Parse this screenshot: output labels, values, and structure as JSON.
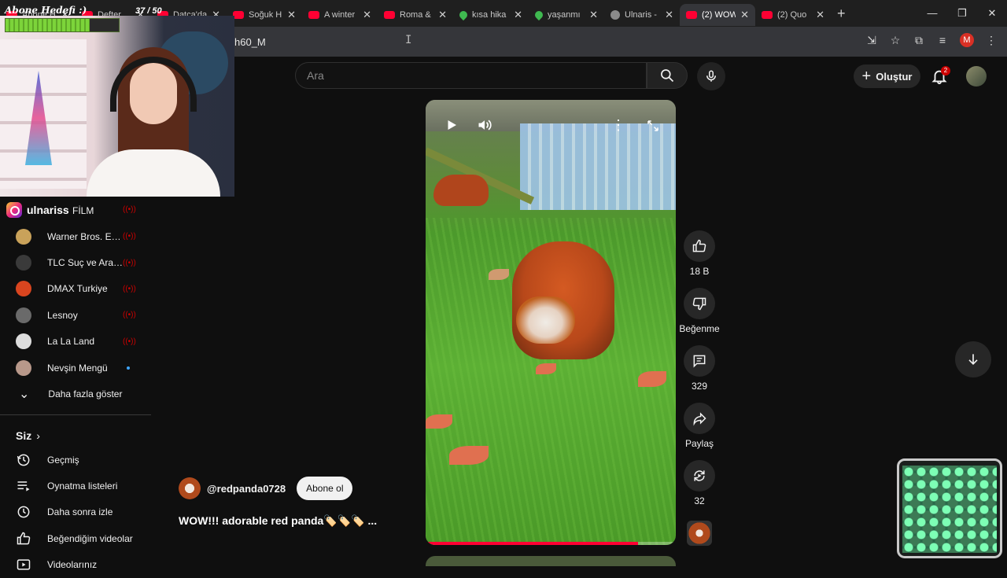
{
  "browser": {
    "tabs": [
      {
        "title": "Abone Hedefi :) zam",
        "icon": "youtube-icon"
      },
      {
        "title": "Defter",
        "icon": "youtube-icon"
      },
      {
        "title": "Datça'da",
        "icon": "youtube-icon"
      },
      {
        "title": "Soğuk H",
        "icon": "youtube-icon"
      },
      {
        "title": "A winter",
        "icon": "youtube-icon"
      },
      {
        "title": "Roma &",
        "icon": "youtube-icon"
      },
      {
        "title": "kısa hika",
        "icon": "leaf-icon"
      },
      {
        "title": "yaşanmı",
        "icon": "leaf-icon"
      },
      {
        "title": "Ulnaris -",
        "icon": "globe-icon"
      },
      {
        "title": "(2) WOW",
        "icon": "youtube-icon",
        "active": true
      },
      {
        "title": "(2) Quo",
        "icon": "youtube-icon"
      }
    ],
    "url_fragment": "h60_M",
    "profile_initial": "M"
  },
  "overlay": {
    "goal_label": "Abone Hedefi :)",
    "goal_count": "37 / 50",
    "goal_progress": 0.74,
    "instagram_handle": "ulnariss"
  },
  "header": {
    "search_placeholder": "Ara",
    "create_label": "Oluştur",
    "notification_count": "2"
  },
  "sidebar": {
    "partial_item": {
      "label": "FİLM",
      "live": true
    },
    "subscriptions": [
      {
        "name": "Warner Bros. Entertainment",
        "avatar_color": "#c9a25a",
        "live": true
      },
      {
        "name": "TLC Suç ve Araştırma",
        "avatar_color": "#3a3a3a",
        "live": true
      },
      {
        "name": "DMAX Turkiye",
        "avatar_color": "#d9451f",
        "live": true
      },
      {
        "name": "Lesnoy",
        "avatar_color": "#6a6a6a",
        "live": true
      },
      {
        "name": "La La Land",
        "avatar_color": "#dddddd",
        "live": true
      },
      {
        "name": "Nevşin Mengü",
        "avatar_color": "#b8988a",
        "new": true
      }
    ],
    "show_more_label": "Daha fazla göster",
    "you_label": "Siz",
    "you_items": [
      {
        "label": "Geçmiş",
        "icon": "history-icon"
      },
      {
        "label": "Oynatma listeleri",
        "icon": "playlists-icon"
      },
      {
        "label": "Daha sonra izle",
        "icon": "watch-later-icon"
      },
      {
        "label": "Beğendiğim videolar",
        "icon": "liked-videos-icon"
      },
      {
        "label": "Videolarınız",
        "icon": "your-videos-icon"
      }
    ]
  },
  "short": {
    "channel_handle": "@redpanda0728",
    "subscribe_label": "Abone ol",
    "title": "WOW!!! adorable red panda🏷️🏷️🏷️ ...",
    "progress": 0.85,
    "likes": "18 B",
    "dislike_label": "Beğenme",
    "comments": "329",
    "share_label": "Paylaş",
    "remix_count": "32"
  }
}
